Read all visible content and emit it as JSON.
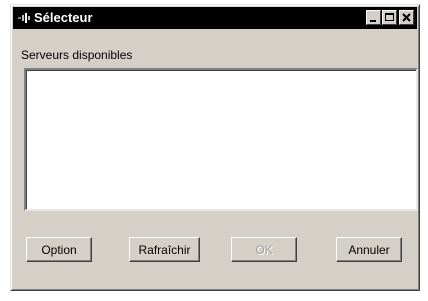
{
  "window": {
    "title": "Sélecteur",
    "icons": {
      "app": "app-icon",
      "minimize": "minimize-icon",
      "maximize": "maximize-icon",
      "close": "close-icon"
    }
  },
  "servers": {
    "label": "Serveurs disponibles",
    "items": []
  },
  "buttons": {
    "option": "Option",
    "refresh": "Rafraîchir",
    "ok": "OK",
    "cancel": "Annuler"
  },
  "colors": {
    "titlebar": "#000000",
    "face": "#d4d0c8",
    "list_background": "#ffffff",
    "disabled_text": "#a0a0a0"
  }
}
